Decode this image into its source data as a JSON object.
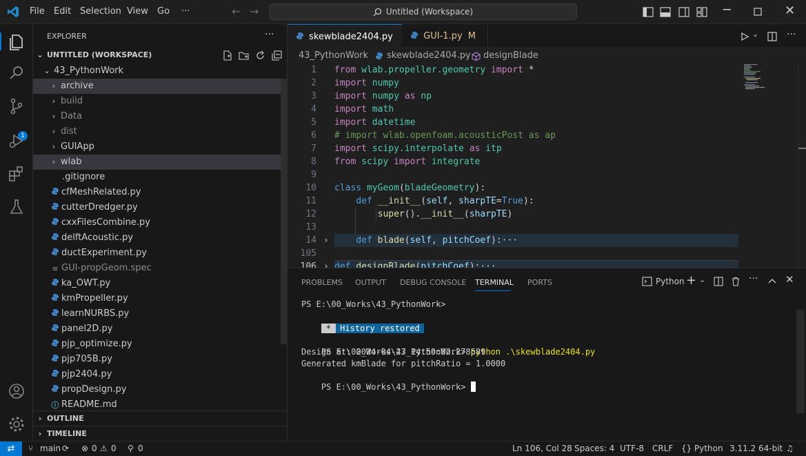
{
  "menu": [
    "File",
    "Edit",
    "Selection",
    "View",
    "Go"
  ],
  "menu_more": "···",
  "command_center": "Untitled (Workspace)",
  "badge_count": "1",
  "explorer": {
    "title": "EXPLORER",
    "more": "···",
    "workspace": "UNTITLED (WORKSPACE)",
    "root": "43_PythonWork",
    "folders": [
      "archive",
      "build",
      "Data",
      "dist",
      "GUIApp",
      "wlab"
    ],
    "files": [
      ".gitignore",
      "cfMeshRelated.py",
      "cutterDredger.py",
      "cxxFilesCombine.py",
      "delftAcoustic.py",
      "ductExperiment.py",
      "GUI-propGeom.spec",
      "ka_OWT.py",
      "kmPropeller.py",
      "learnNURBS.py",
      "panel2D.py",
      "pjp_optimize.py",
      "pjp705B.py",
      "pjp2404.py",
      "propDesign.py",
      "README.md"
    ],
    "outline": "OUTLINE",
    "timeline": "TIMELINE"
  },
  "tabs": [
    {
      "label": "skewblade2404.py",
      "close": "×"
    },
    {
      "label": "GUI-1.py",
      "status": "M"
    }
  ],
  "breadcrumb": [
    "43_PythonWork",
    "skewblade2404.py",
    "designBlade"
  ],
  "editor": {
    "line_numbers": [
      "1",
      "2",
      "3",
      "4",
      "5",
      "6",
      "7",
      "8",
      "9",
      "10",
      "11",
      "12",
      "13",
      "14",
      "105",
      "106"
    ],
    "lines": [
      "from wlab.propeller.geometry import *",
      "import numpy",
      "import numpy as np",
      "import math",
      "import datetime",
      "# import wlab.openfoam.acousticPost as ap",
      "import scipy.interpolate as itp",
      "from scipy import integrate",
      "",
      "class myGeom(bladeGeometry):",
      "    def __init__(self, sharpTE=True):",
      "        super().__init__(sharpTE)",
      "",
      "    def blade(self, pitchCoef):···",
      "",
      "def designBlade(pitchCoef):···"
    ]
  },
  "panel": {
    "tabs": [
      "PROBLEMS",
      "OUTPUT",
      "DEBUG CONSOLE",
      "TERMINAL",
      "PORTS"
    ],
    "terminal_name": "Python",
    "terminal": {
      "prompt1": "PS E:\\00_Works\\43_PythonWork>",
      "history_star": "*",
      "history": "History restored",
      "prompt2": "PS E:\\00_Works\\43_PythonWork>",
      "command": "python .\\skewblade2404.py",
      "out1": "Design at: 2024-04-27 14:59:02.278589",
      "out2": "Generated kmBlade for pitchRatio = 1.0000",
      "prompt3": "PS E:\\00_Works\\43_PythonWork>"
    }
  },
  "status": {
    "branch": "main",
    "errors": "0",
    "warnings": "0",
    "ports": "0",
    "position": "Ln 106, Col 28",
    "spaces": "Spaces: 4",
    "encoding": "UTF-8",
    "eol": "CRLF",
    "language": "Python",
    "interpreter": "3.11.2 64-bit"
  }
}
